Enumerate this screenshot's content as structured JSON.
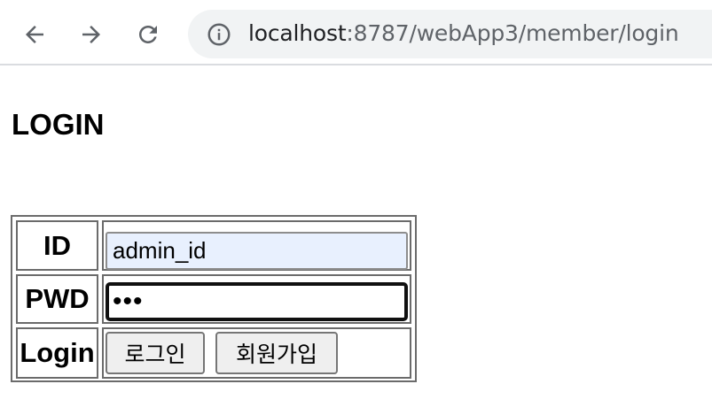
{
  "browser": {
    "url_host": "localhost",
    "url_path": ":8787/webApp3/member/login",
    "icons": {
      "back": "back-arrow-icon",
      "forward": "forward-arrow-icon",
      "reload": "reload-icon",
      "site_info": "info-icon"
    }
  },
  "page": {
    "title": "LOGIN"
  },
  "login_form": {
    "id_label": "ID",
    "id_value": "admin_id",
    "pwd_label": "PWD",
    "pwd_masked_value": "•••",
    "login_label": "Login",
    "login_button": "로그인",
    "signup_button": "회원가입"
  },
  "colors": {
    "autofill_background": "#e8f0fe",
    "omnibox_background": "#f1f3f4",
    "button_background": "#efefef"
  }
}
